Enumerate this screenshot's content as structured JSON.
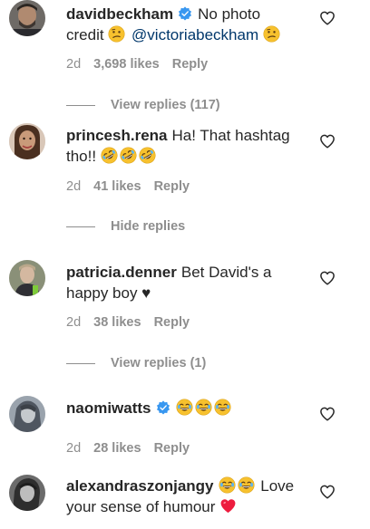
{
  "comments": [
    {
      "username": "davidbeckham",
      "verified": true,
      "text_a": "No photo",
      "text_b": "credit",
      "mention": "@victoriabeckham",
      "time": "2d",
      "likes": "3,698 likes",
      "reply": "Reply",
      "replies_toggle": "View replies (117)"
    },
    {
      "username": "princesh.rena",
      "text": "Ha! That hashtag tho!!",
      "time": "2d",
      "likes": "41 likes",
      "reply": "Reply",
      "replies_toggle": "Hide replies"
    },
    {
      "username": "patricia.denner",
      "text": "Bet David's a happy boy ♥",
      "time": "2d",
      "likes": "38 likes",
      "reply": "Reply",
      "replies_toggle": "View replies (1)"
    },
    {
      "username": "naomiwatts",
      "verified": true,
      "time": "2d",
      "likes": "28 likes",
      "reply": "Reply"
    },
    {
      "username": "alexandraszonjangy",
      "text_a": "Love",
      "text_b": "your sense of humour"
    }
  ],
  "colors": {
    "primary_text": "#262626",
    "secondary_text": "#8e8e8e",
    "mention": "#00376b",
    "verified": "#3897f0",
    "heart_red": "#ed1c3e"
  }
}
